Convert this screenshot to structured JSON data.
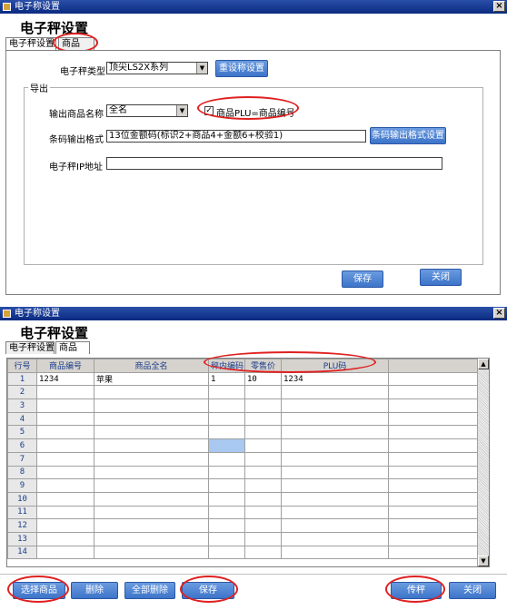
{
  "window_top": {
    "title": "电子称设置",
    "close_glyph": "×",
    "heading": "电子秤设置",
    "tabs": [
      "电子秤设置",
      "商品"
    ],
    "scale_type": {
      "label": "电子秤类型",
      "value": "顶尖LS2X系列",
      "reset_button": "重设称设置"
    },
    "export_group": {
      "title": "导出",
      "name_label": "输出商品名称",
      "name_value": "全名",
      "checkbox_label": "商品PLU=商品编号",
      "checkbox_checked": true,
      "checkbox_mark": "✓",
      "barcode_label": "条码输出格式",
      "barcode_value": "13位金额码(标识2+商品4+金额6+校验1)",
      "barcode_button": "条码输出格式设置",
      "ip_label": "电子秤IP地址",
      "ip_value": ""
    },
    "buttons": {
      "save": "保存",
      "close": "关闭"
    }
  },
  "window_bottom": {
    "title": "电子称设置",
    "close_glyph": "×",
    "heading": "电子秤设置",
    "tabs": [
      "电子秤设置",
      "商品"
    ],
    "grid": {
      "columns": [
        "行号",
        "商品编号",
        "商品全名",
        "秤内编码",
        "零售价",
        "PLU码"
      ],
      "rows": [
        [
          "1",
          "1234",
          "苹果",
          "1",
          "10",
          "1234"
        ],
        [
          "2",
          "",
          "",
          "",
          "",
          ""
        ],
        [
          "3",
          "",
          "",
          "",
          "",
          ""
        ],
        [
          "4",
          "",
          "",
          "",
          "",
          ""
        ],
        [
          "5",
          "",
          "",
          "",
          "",
          ""
        ],
        [
          "6",
          "",
          "",
          "",
          "",
          ""
        ],
        [
          "7",
          "",
          "",
          "",
          "",
          ""
        ],
        [
          "8",
          "",
          "",
          "",
          "",
          ""
        ],
        [
          "9",
          "",
          "",
          "",
          "",
          ""
        ],
        [
          "10",
          "",
          "",
          "",
          "",
          ""
        ],
        [
          "11",
          "",
          "",
          "",
          "",
          ""
        ],
        [
          "12",
          "",
          "",
          "",
          "",
          ""
        ],
        [
          "13",
          "",
          "",
          "",
          "",
          ""
        ],
        [
          "14",
          "",
          "",
          "",
          "",
          ""
        ]
      ],
      "current_row_marker": "▶",
      "scroll_up": "▲",
      "scroll_down": "▼"
    },
    "buttons": {
      "select_goods": "选择商品",
      "delete": "删除",
      "delete_all": "全部删除",
      "save": "保存",
      "transfer": "传秤",
      "close": "关闭"
    }
  },
  "colors": {
    "titlebar": "#0a2a80",
    "button": "#3d74c9",
    "highlight_ring": "#e02020",
    "selected_cell": "#a8c8f0"
  }
}
